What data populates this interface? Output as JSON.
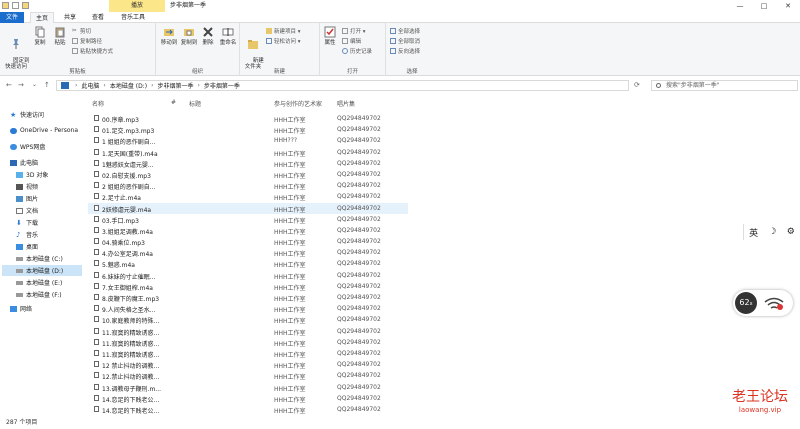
{
  "titlebar": {
    "context_tab": "播放",
    "title": "步非烟第一季",
    "minimize": "—",
    "maximize": "□",
    "close": "✕"
  },
  "tabs": {
    "file": "文件",
    "home": "主页",
    "share": "共享",
    "view": "查看",
    "music": "音乐工具"
  },
  "ribbon": {
    "clipboard": {
      "group": "剪贴板",
      "pin": "固定到\n快速访问",
      "copy": "复制",
      "paste": "粘贴",
      "cut": "剪切",
      "copy_path": "复制路径",
      "paste_shortcut": "粘贴快捷方式"
    },
    "organize": {
      "group": "组织",
      "move_to": "移动到",
      "copy_to": "复制到",
      "delete": "删除",
      "rename": "重命名"
    },
    "new": {
      "group": "新建",
      "new_folder": "新建\n文件夹",
      "new_item": "新建项目 ▾",
      "easy_access": "轻松访问 ▾"
    },
    "open": {
      "group": "打开",
      "properties": "属性",
      "open": "打开 ▾",
      "edit": "编辑",
      "history": "历史记录"
    },
    "select": {
      "group": "选择",
      "select_all": "全部选择",
      "select_none": "全部取消",
      "invert": "反向选择"
    }
  },
  "address": {
    "back": "←",
    "forward": "→",
    "down": "⌄",
    "up": "↑",
    "segments": [
      "此电脑",
      "本地磁盘 (D:)",
      "步非烟第一季",
      "步非烟第一季"
    ],
    "refresh": "⟳",
    "search_placeholder": "搜索\"步非烟第一季\""
  },
  "nav": {
    "items": [
      {
        "label": "快速访问",
        "icon": "star-icon"
      },
      {
        "label": "OneDrive - Persona",
        "icon": "cloud-icon"
      },
      {
        "label": "WPS网盘",
        "icon": "cloud-icon"
      },
      {
        "label": "此电脑",
        "icon": "computer-icon"
      },
      {
        "label": "3D 对象",
        "icon": "cube-icon"
      },
      {
        "label": "视频",
        "icon": "video-icon"
      },
      {
        "label": "图片",
        "icon": "picture-icon"
      },
      {
        "label": "文档",
        "icon": "document-icon"
      },
      {
        "label": "下载",
        "icon": "download-icon"
      },
      {
        "label": "音乐",
        "icon": "music-icon"
      },
      {
        "label": "桌面",
        "icon": "desktop-icon"
      },
      {
        "label": "本地磁盘 (C:)",
        "icon": "drive-icon"
      },
      {
        "label": "本地磁盘 (D:)",
        "icon": "drive-icon"
      },
      {
        "label": "本地磁盘 (E:)",
        "icon": "drive-icon"
      },
      {
        "label": "本地磁盘 (F:)",
        "icon": "drive-icon"
      },
      {
        "label": "网络",
        "icon": "network-icon"
      }
    ]
  },
  "columns": {
    "name": "名称",
    "number": "#",
    "title": "标题",
    "artist": "参与创作的艺术家",
    "album": "唱片集"
  },
  "files": [
    {
      "name": "00.序章.mp3",
      "artist": "HHH工作室",
      "album": "QQ294849702"
    },
    {
      "name": "01.足交.mp3.mp3",
      "artist": "HHH工作室",
      "album": "QQ294849702"
    },
    {
      "name": "1 姐姐的恶作剧自...",
      "artist": "HHH???",
      "album": "QQ294849702"
    },
    {
      "name": "1.足天国(重带).m4a",
      "artist": "HHH工作室",
      "album": "QQ294849702"
    },
    {
      "name": "1魅惑妖女虐元婴...",
      "artist": "HHH工作室",
      "album": "QQ294849702"
    },
    {
      "name": "02.自慰支援.mp3",
      "artist": "HHH工作室",
      "album": "QQ294849702"
    },
    {
      "name": "2 姐姐的恶作剧自...",
      "artist": "HHH工作室",
      "album": "QQ294849702"
    },
    {
      "name": "2.足寸止.m4a",
      "artist": "HHH工作室",
      "album": "QQ294849702"
    },
    {
      "name": "2妖修虐元婴.m4a",
      "artist": "HHH工作室",
      "album": "QQ294849702"
    },
    {
      "name": "03.手口.mp3",
      "artist": "HHH工作室",
      "album": "QQ294849702"
    },
    {
      "name": "3.姐姐足调教.m4a",
      "artist": "HHH工作室",
      "album": "QQ294849702"
    },
    {
      "name": "04.骑乘位.mp3",
      "artist": "HHH工作室",
      "album": "QQ294849702"
    },
    {
      "name": "4.办公室足调.m4a",
      "artist": "HHH工作室",
      "album": "QQ294849702"
    },
    {
      "name": "5.魅惑.m4a",
      "artist": "HHH工作室",
      "album": "QQ294849702"
    },
    {
      "name": "6.妹妹的寸止催眠...",
      "artist": "HHH工作室",
      "album": "QQ294849702"
    },
    {
      "name": "7.女王御姐榨.m4a",
      "artist": "HHH工作室",
      "album": "QQ294849702"
    },
    {
      "name": "8.皮鞭下的魔王.mp3",
      "artist": "HHH工作室",
      "album": "QQ294849702"
    },
    {
      "name": "9.人间失格之圣水...",
      "artist": "HHH工作室",
      "album": "QQ294849702"
    },
    {
      "name": "10.家庭教师的特殊...",
      "artist": "HHH工作室",
      "album": "QQ294849702"
    },
    {
      "name": "11.寂寞的精致诱惑...",
      "artist": "HHH工作室",
      "album": "QQ294849702"
    },
    {
      "name": "11.寂寞的精致诱惑...",
      "artist": "HHH工作室",
      "album": "QQ294849702"
    },
    {
      "name": "11.寂寞的精致诱惑...",
      "artist": "HHH工作室",
      "album": "QQ294849702"
    },
    {
      "name": "12 禁止抖动的调教...",
      "artist": "HHH工作室",
      "album": "QQ294849702"
    },
    {
      "name": "12.禁止抖动的调教...",
      "artist": "HHH工作室",
      "album": "QQ294849702"
    },
    {
      "name": "13.调教母子鞭刑.m...",
      "artist": "HHH工作室",
      "album": "QQ294849702"
    },
    {
      "name": "14.恋足的下贱老公...",
      "artist": "HHH工作室",
      "album": "QQ294849702"
    },
    {
      "name": "14.恋足的下贱老公...",
      "artist": "HHH工作室",
      "album": "QQ294849702"
    }
  ],
  "status": {
    "count": "287 个项目"
  },
  "ime": {
    "lang": "英",
    "moon": "☽",
    "gear": "⚙"
  },
  "speed": {
    "value": "62",
    "unit": "x"
  },
  "watermark": {
    "title": "老王论坛",
    "url": "laowang.vip"
  }
}
